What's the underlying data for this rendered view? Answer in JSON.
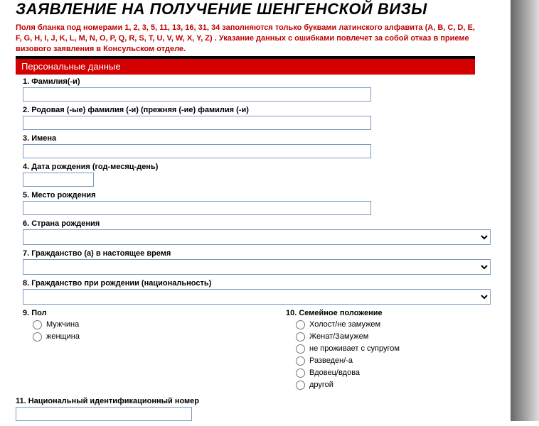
{
  "title": "ЗАЯВЛЕНИЕ НА ПОЛУЧЕНИЕ ШЕНГЕНСКОЙ ВИЗЫ",
  "warning": "Поля бланка под номерами 1, 2, 3, 5, 11, 13, 16, 31, 34 заполняются только буквами латинского алфавита (A, B, C, D, E, F, G, H, I, J, K, L, M, N, O, P, Q, R, S, T, U, V, W, X, Y, Z) . Указание данных с ошибками повлечет за собой отказ в приеме визового заявления в Консульском отделе.",
  "section_personal": "Персональные данные",
  "fields": {
    "q1": "1. Фамилия(-и)",
    "q2": "2. Родовая (-ые) фамилия (-и) (прежняя (-ие) фамилия (-и)",
    "q3": "3. Имена",
    "q4": "4. Дата рождения (год-месяц-день)",
    "q5": "5. Место рождения",
    "q6": "6. Страна рождения",
    "q7": "7. Гражданство (а) в настоящее время",
    "q8": "8. Гражданство при рождении (национальность)",
    "q9": "9. Пол",
    "q10": "10. Семейное положение",
    "q11": "11. Национальный идентификационный номер"
  },
  "gender": {
    "male": "Мужчина",
    "female": "женщина"
  },
  "marital": {
    "single": "Холост/не замужем",
    "married": "Женат/Замужем",
    "separated": "не проживает с супругом",
    "divorced": "Разведен/-а",
    "widowed": "Вдовец/вдова",
    "other": "другой"
  }
}
